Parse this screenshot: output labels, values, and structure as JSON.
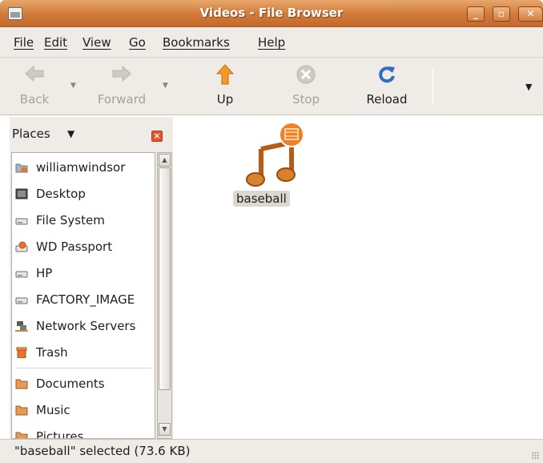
{
  "window": {
    "title": "Videos - File Browser",
    "controls": [
      "minimize-icon",
      "maximize-icon",
      "close-icon"
    ]
  },
  "menubar": {
    "items": [
      {
        "label": "File"
      },
      {
        "label": "Edit"
      },
      {
        "label": "View"
      },
      {
        "label": "Go"
      },
      {
        "label": "Bookmarks"
      },
      {
        "label": "Help"
      }
    ]
  },
  "toolbar": {
    "back": {
      "label": "Back",
      "icon": "left-arrow-icon",
      "enabled": false
    },
    "forward": {
      "label": "Forward",
      "icon": "right-arrow-icon",
      "enabled": false
    },
    "up": {
      "label": "Up",
      "icon": "up-arrow-icon",
      "enabled": true
    },
    "stop": {
      "label": "Stop",
      "icon": "stop-icon",
      "enabled": false
    },
    "reload": {
      "label": "Reload",
      "icon": "reload-icon",
      "enabled": true
    },
    "overflow": {
      "icon": "chevron-down-icon"
    }
  },
  "sidebar": {
    "header": {
      "label": "Places",
      "icon": "chevron-down-icon",
      "close_icon": "close-icon"
    },
    "items": [
      {
        "label": "williamwindsor",
        "icon": "home-folder-icon"
      },
      {
        "label": "Desktop",
        "icon": "desktop-icon"
      },
      {
        "label": "File System",
        "icon": "drive-icon"
      },
      {
        "label": "WD Passport",
        "icon": "usb-drive-icon"
      },
      {
        "label": "HP",
        "icon": "drive-icon"
      },
      {
        "label": "FACTORY_IMAGE",
        "icon": "drive-icon"
      },
      {
        "label": "Network Servers",
        "icon": "network-icon"
      },
      {
        "label": "Trash",
        "icon": "trash-icon"
      },
      {
        "label": "Documents",
        "icon": "folder-icon"
      },
      {
        "label": "Music",
        "icon": "folder-icon"
      },
      {
        "label": "Pictures",
        "icon": "folder-icon"
      }
    ]
  },
  "content": {
    "files": [
      {
        "name": "baseball",
        "icon": "music-video-file-icon",
        "selected": true
      }
    ]
  },
  "statusbar": {
    "text": "\"baseball\" selected (73.6 KB)"
  },
  "colors": {
    "titlebar": "#d07a3a",
    "chrome": "#efebe7",
    "accent": "#e8742a",
    "selection": "#dcd7d1"
  }
}
